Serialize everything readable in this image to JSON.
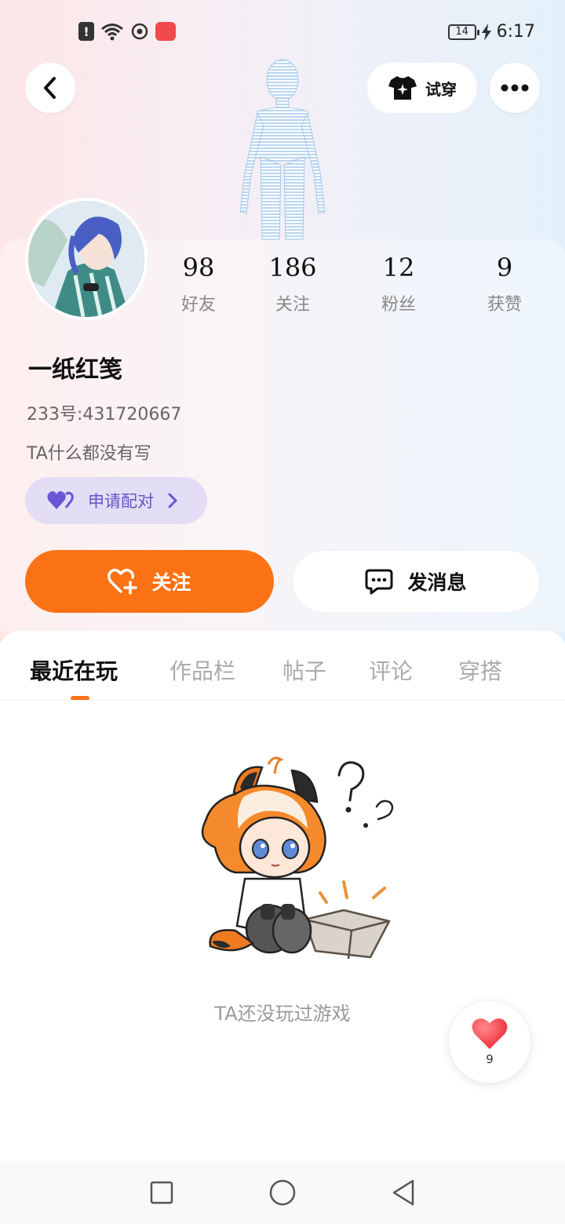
{
  "status_bar": {
    "time": "6:17",
    "battery": "14"
  },
  "header": {
    "try_on_label": "试穿"
  },
  "profile": {
    "username": "一纸红笺",
    "uid_text": "233号:431720667",
    "bio": "TA什么都没有写",
    "pair_label": "申请配对",
    "stats": [
      {
        "value": "98",
        "label": "好友"
      },
      {
        "value": "186",
        "label": "关注"
      },
      {
        "value": "12",
        "label": "粉丝"
      },
      {
        "value": "9",
        "label": "获赞"
      }
    ]
  },
  "actions": {
    "follow_label": "关注",
    "message_label": "发消息"
  },
  "tabs": [
    {
      "label": "最近在玩",
      "active": true
    },
    {
      "label": "作品栏",
      "active": false
    },
    {
      "label": "帖子",
      "active": false
    },
    {
      "label": "评论",
      "active": false
    },
    {
      "label": "穿搭",
      "active": false
    }
  ],
  "empty_state": {
    "text": "TA还没玩过游戏"
  },
  "like_fab": {
    "count": "9"
  },
  "colors": {
    "accent": "#fb7214",
    "pair_bg": "#e4ddf6",
    "pair_text": "#6653c9"
  }
}
